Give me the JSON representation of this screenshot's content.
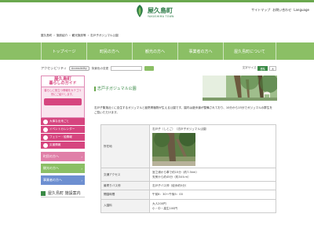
{
  "header": {
    "logo_jp": "屋久島町",
    "logo_en": "YAKUSHIMA TOWN",
    "util_links": [
      "サイトマップ",
      "お問い合わせ",
      "Language"
    ]
  },
  "breadcrumb": [
    "屋久島町",
    "施設紹介",
    "観光施設等",
    "志戸子ガジュマル公園"
  ],
  "nav": [
    "トップページ",
    "町民の方へ",
    "観光の方へ",
    "事業者の方へ",
    "屋久島町について"
  ],
  "access": {
    "label": "アクセシビリティ",
    "tool": "Accessibility",
    "search_label": "背景色の変更",
    "fontsize_label": "文字サイズ",
    "font_options": [
      "標準",
      "大"
    ]
  },
  "sidebar": {
    "head_1": "屋久島町",
    "head_2": "暮らしのガイド",
    "promo": "暮らしに役立つ情報をカテゴリ別にご紹介します。",
    "items": [
      "大事な出来ごと",
      "イベントカレンダー",
      "フェリー・船情報",
      "災害情報"
    ],
    "buttons": [
      "町民の方へ",
      "観光の方へ",
      "事業者の方へ"
    ],
    "facility": "屋久島町 施設案内"
  },
  "main": {
    "page_title": "志戸子ガジュマル公園",
    "description": "志戸子集落近くに自生するガジュマルと亜熱帯植物が生える公園です。園内は遊歩道が整備されており、10分から15分でガジュマルの群生をご覧いただけます。",
    "rows": [
      {
        "head": "所在地",
        "lines": [
          "志戸子（しとご）　（志戸子ガジュマル公園）"
        ]
      },
      {
        "head": "交通アクセス",
        "lines": [
          "宮之浦から車で約15分（約7.5km）",
          "安房から約45分（約34ｋｍ）"
        ]
      },
      {
        "head": "最寄りバス停",
        "lines": [
          "志戸子バス停（徒歩約5分）"
        ]
      },
      {
        "head": "開園時間",
        "lines": [
          "午前8：30～午後5：00"
        ]
      },
      {
        "head": "入園料",
        "lines": [
          "大人200円",
          "小・中・高生100円"
        ]
      }
    ]
  },
  "colors": {
    "accent": "#8bbf65",
    "pink": "#d6457f",
    "green": "#3a8a46"
  }
}
